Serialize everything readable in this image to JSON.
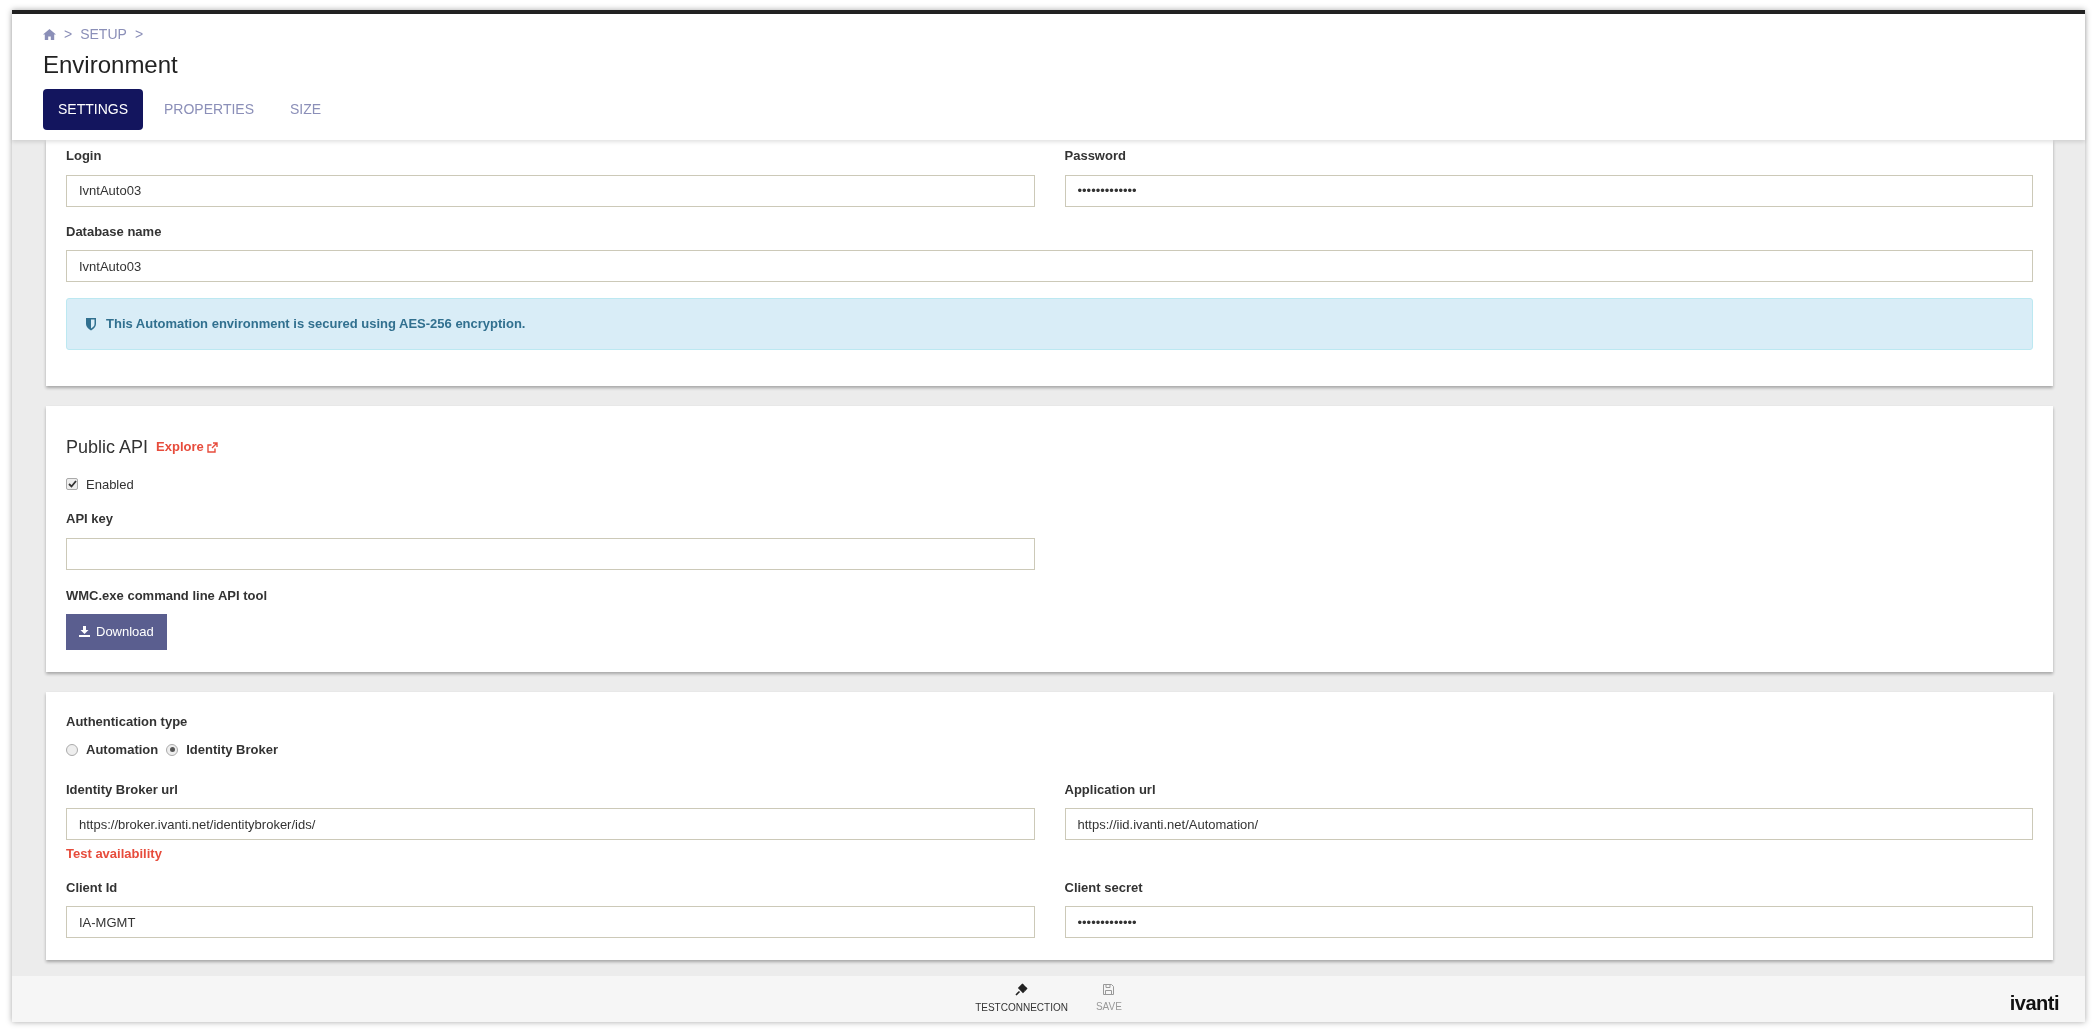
{
  "breadcrumb": {
    "items": [
      "SETUP"
    ],
    "separator": ">"
  },
  "title": "Environment",
  "tabs": [
    {
      "label": "SETTINGS",
      "selected": true
    },
    {
      "label": "PROPERTIES",
      "selected": false
    },
    {
      "label": "SIZE",
      "selected": false
    }
  ],
  "database_section": {
    "fields": [
      {
        "label": "Login",
        "value": "IvntAuto03"
      },
      {
        "label": "Password",
        "value": "•••••••••••••"
      },
      {
        "label": "Database name",
        "value": "IvntAuto03",
        "wide": true
      }
    ],
    "notice": "This Automation environment is secured using AES-256 encryption."
  },
  "public_api": {
    "title": "Public API",
    "explore_link": "Explore",
    "enabled": {
      "label": "Enabled",
      "checked": true
    },
    "api_key": {
      "label": "API key"
    },
    "tool_label": "WMC.exe command line API tool",
    "download_button": "Download"
  },
  "authentication": {
    "label": "Authentication type",
    "options": [
      {
        "label": "Automation",
        "selected": false
      },
      {
        "label": "Identity Broker",
        "selected": true
      }
    ],
    "fields": [
      {
        "label": "Identity Broker url",
        "value": "https://broker.ivanti.net/identitybroker/ids/",
        "link": "Test availability"
      },
      {
        "label": "Application url",
        "value": "https://iid.ivanti.net/Automation/"
      },
      {
        "label": "Client Id",
        "value": "IA-MGMT"
      },
      {
        "label": "Client secret",
        "value": "•••••••••••••"
      }
    ]
  },
  "toolbar": {
    "actions": [
      {
        "label": "TESTCONNECTION",
        "kind": "plug",
        "disabled": false
      },
      {
        "label": "SAVE",
        "kind": "save",
        "disabled": true
      }
    ]
  },
  "logo": "ivanti"
}
